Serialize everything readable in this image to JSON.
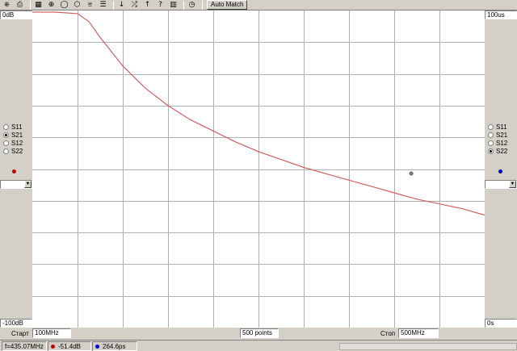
{
  "toolbar": {
    "buttons": [
      {
        "name": "network-icon",
        "glyph": "⎈"
      },
      {
        "name": "print-icon",
        "glyph": "⎙"
      },
      {
        "name": "calibrate-icon",
        "glyph": "▦"
      },
      {
        "name": "crosshair-icon",
        "glyph": "⊕"
      },
      {
        "name": "circle-icon",
        "glyph": "◯"
      },
      {
        "name": "hexagon-icon",
        "glyph": "⬡"
      },
      {
        "name": "scale-icon",
        "glyph": "⩸"
      },
      {
        "name": "lines-icon",
        "glyph": "☰"
      },
      {
        "name": "arrow-down-icon",
        "glyph": "↓"
      },
      {
        "name": "marker-swap-icon",
        "glyph": "⤮"
      },
      {
        "name": "arrow-up-icon",
        "glyph": "↑"
      },
      {
        "name": "help-icon",
        "glyph": "?"
      },
      {
        "name": "grid-icon",
        "glyph": "▥"
      },
      {
        "name": "clock-icon",
        "glyph": "◷"
      }
    ],
    "auto_match_label": "Auto Match"
  },
  "left_panel": {
    "top_scale": "0dB",
    "bottom_scale": "-100dB",
    "params": [
      "S11",
      "S21",
      "S12",
      "S22"
    ],
    "selected": "S21",
    "marker_color": "#c00000"
  },
  "right_panel": {
    "top_scale": "100us",
    "bottom_scale": "0s",
    "params": [
      "S11",
      "S21",
      "S12",
      "S22"
    ],
    "selected": "S22",
    "marker_color": "#0000c0"
  },
  "controls": {
    "start_label": "Старт",
    "start_value": "100MHz",
    "points_value": "500 points",
    "stop_label": "Стоп",
    "stop_value": "500MHz"
  },
  "status": {
    "frequency": "f=435.07MHz",
    "magnitude": "-51.4dB",
    "delay": "264.6ps"
  },
  "chart_data": {
    "type": "line",
    "grid": true,
    "x_divisions": 10,
    "y_divisions": 10,
    "ylim": [
      -100,
      0
    ],
    "xlim": [
      100,
      500
    ],
    "trace_color": "#d06060",
    "series": [
      {
        "x": [
          100,
          120,
          140,
          150,
          160,
          180,
          200,
          220,
          240,
          260,
          280,
          300,
          320,
          340,
          360,
          380,
          400,
          420,
          440,
          460,
          480,
          500
        ],
        "y": [
          -0.5,
          -0.5,
          -1.0,
          -3.5,
          -8.5,
          -17.5,
          -24.5,
          -30.0,
          -34.5,
          -38.0,
          -41.5,
          -44.5,
          -47.0,
          -49.5,
          -51.5,
          -53.5,
          -55.5,
          -57.5,
          -59.5,
          -61.0,
          -62.5,
          -64.5
        ]
      }
    ],
    "marker": {
      "x": 435.07,
      "y": -51.4
    }
  }
}
